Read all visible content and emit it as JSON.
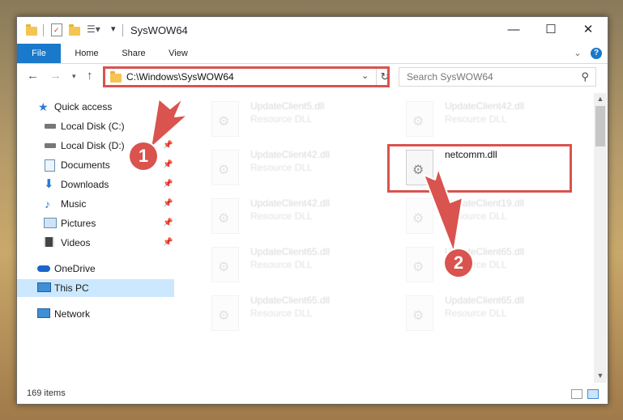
{
  "window": {
    "title": "SysWOW64",
    "controls": {
      "minimize": "—",
      "maximize": "☐",
      "close": "✕"
    }
  },
  "ribbon": {
    "tabs": [
      "File",
      "Home",
      "Share",
      "View"
    ],
    "expand_icon": "chevron-down-icon",
    "help_icon": "help-icon"
  },
  "nav": {
    "address": "C:\\Windows\\SysWOW64",
    "search_placeholder": "Search SysWOW64"
  },
  "sidebar": {
    "items": [
      {
        "label": "Quick access",
        "icon": "star-icon",
        "pinned": false
      },
      {
        "label": "Local Disk (C:)",
        "icon": "drive-icon",
        "pinned": true
      },
      {
        "label": "Local Disk (D:)",
        "icon": "drive-icon",
        "pinned": true
      },
      {
        "label": "Documents",
        "icon": "documents-icon",
        "pinned": true
      },
      {
        "label": "Downloads",
        "icon": "download-icon",
        "pinned": true
      },
      {
        "label": "Music",
        "icon": "music-icon",
        "pinned": true
      },
      {
        "label": "Pictures",
        "icon": "pictures-icon",
        "pinned": true
      },
      {
        "label": "Videos",
        "icon": "videos-icon",
        "pinned": true
      },
      {
        "label": "OneDrive",
        "icon": "cloud-icon",
        "pinned": false
      },
      {
        "label": "This PC",
        "icon": "computer-icon",
        "pinned": false,
        "selected": true
      },
      {
        "label": "Network",
        "icon": "network-icon",
        "pinned": false
      }
    ]
  },
  "files": [
    {
      "name": "UpdateClient5.dll",
      "type": "Resource DLL"
    },
    {
      "name": "UpdateClient42.dll",
      "type": "Resource DLL"
    },
    {
      "name": "UpdateClient42.dll",
      "type": "Resource DLL"
    },
    {
      "name": "netcomm.dll",
      "type": ""
    },
    {
      "name": "UpdateClient42.dll",
      "type": "Resource DLL"
    },
    {
      "name": "UpdateClient19.dll",
      "type": "Resource DLL"
    },
    {
      "name": "UpdateClient65.dll",
      "type": "Resource DLL"
    },
    {
      "name": "UpdateClient65.dll",
      "type": "Resource DLL"
    },
    {
      "name": "UpdateClient65.dll",
      "type": "Resource DLL"
    },
    {
      "name": "UpdateClient65.dll",
      "type": "Resource DLL"
    }
  ],
  "status": {
    "item_count": "169 items"
  },
  "callouts": [
    "1",
    "2"
  ],
  "colors": {
    "accent": "#1979ca",
    "highlight": "#d9534f",
    "selected": "#cce8ff"
  }
}
